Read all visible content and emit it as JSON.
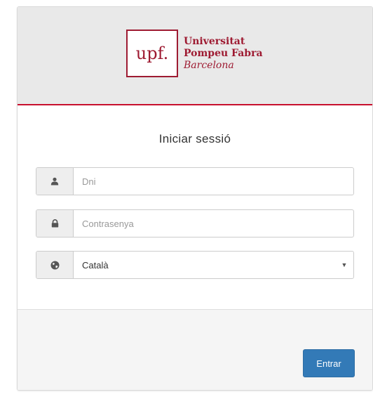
{
  "brand": {
    "logo_mark": "upf.",
    "line1": "Universitat",
    "line2": "Pompeu Fabra",
    "line3": "Barcelona",
    "color": "#9e1b32"
  },
  "form": {
    "title": "Iniciar sessió",
    "username": {
      "placeholder": "Dni",
      "value": "",
      "icon": "user-icon"
    },
    "password": {
      "placeholder": "Contrasenya",
      "value": "",
      "icon": "lock-icon"
    },
    "language": {
      "selected": "Català",
      "icon": "globe-icon"
    },
    "submit_label": "Entrar"
  },
  "colors": {
    "accent_line": "#c8102e",
    "button": "#337ab7"
  }
}
